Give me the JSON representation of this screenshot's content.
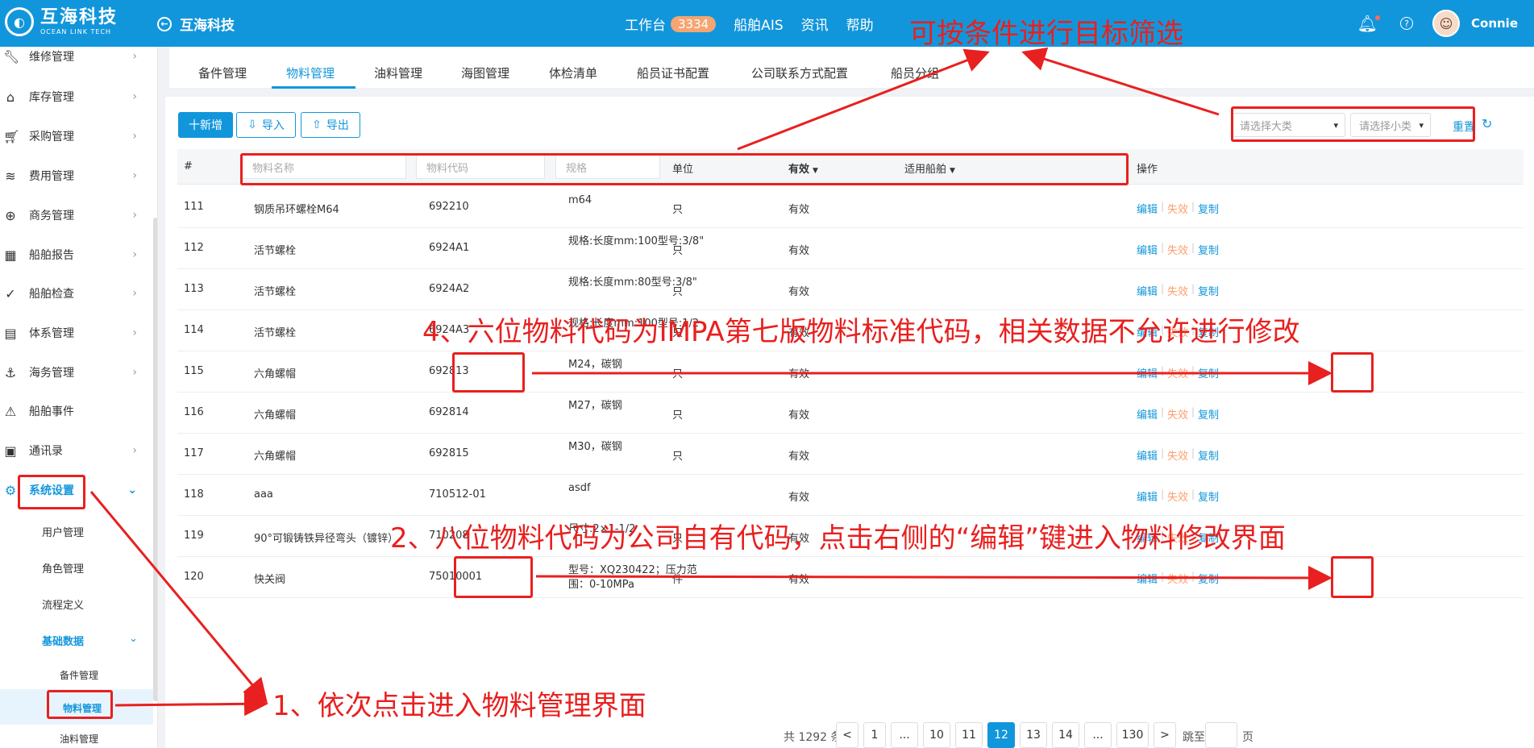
{
  "brand": {
    "name_cn": "互海科技",
    "name_en": "OCEAN LINK TECH"
  },
  "header": {
    "back_label": "互海科技",
    "nav": [
      {
        "label": "工作台",
        "badge": "3334"
      },
      {
        "label": "船舶AIS"
      },
      {
        "label": "资讯"
      },
      {
        "label": "帮助"
      }
    ],
    "username": "Connie"
  },
  "sidebar": {
    "items": [
      {
        "label": "维修管理",
        "icon": "wrench-icon"
      },
      {
        "label": "库存管理",
        "icon": "warehouse-icon"
      },
      {
        "label": "采购管理",
        "icon": "cart-icon"
      },
      {
        "label": "费用管理",
        "icon": "coins-icon"
      },
      {
        "label": "商务管理",
        "icon": "globe-icon"
      },
      {
        "label": "船舶报告",
        "icon": "calendar-icon"
      },
      {
        "label": "船舶检查",
        "icon": "check-circle-icon"
      },
      {
        "label": "体系管理",
        "icon": "document-icon"
      },
      {
        "label": "海务管理",
        "icon": "anchor-icon"
      },
      {
        "label": "船舶事件",
        "icon": "warning-icon"
      },
      {
        "label": "通讯录",
        "icon": "contacts-icon"
      },
      {
        "label": "系统设置",
        "icon": "gear-icon"
      }
    ],
    "sub_items": [
      "用户管理",
      "角色管理",
      "流程定义",
      "基础数据"
    ],
    "sub_sub_items": [
      "备件管理",
      "物料管理",
      "油料管理"
    ]
  },
  "tabs": [
    "备件管理",
    "物料管理",
    "油料管理",
    "海图管理",
    "体检清单",
    "船员证书配置",
    "公司联系方式配置",
    "船员分组"
  ],
  "toolbar": {
    "add": "十新增",
    "import": "导入",
    "export": "导出",
    "category_placeholder": "请选择大类",
    "subcategory_placeholder": "请选择小类",
    "reset": "重置"
  },
  "table": {
    "headers": {
      "index": "#",
      "name_placeholder": "物料名称",
      "code_placeholder": "物料代码",
      "spec_placeholder": "规格",
      "unit": "单位",
      "valid": "有效",
      "ship": "适用船舶",
      "actions": "操作"
    },
    "actions": {
      "edit": "编辑",
      "disable": "失效",
      "copy": "复制"
    },
    "rows": [
      {
        "no": "111",
        "name": "钢质吊环螺栓M64",
        "code": "692210",
        "spec": "m64",
        "unit": "只",
        "valid": "有效"
      },
      {
        "no": "112",
        "name": "活节螺栓",
        "code": "6924A1",
        "spec": "规格:长度mm:100型号:3/8\"",
        "unit": "只",
        "valid": "有效"
      },
      {
        "no": "113",
        "name": "活节螺栓",
        "code": "6924A2",
        "spec": "规格:长度mm:80型号:3/8\"",
        "unit": "只",
        "valid": "有效"
      },
      {
        "no": "114",
        "name": "活节螺栓",
        "code": "6924A3",
        "spec": "规格:长度mm:100型号:1/2",
        "unit": "只",
        "valid": "有效"
      },
      {
        "no": "115",
        "name": "六角螺帽",
        "code": "692813",
        "spec": "M24，碳钢",
        "unit": "只",
        "valid": "有效"
      },
      {
        "no": "116",
        "name": "六角螺帽",
        "code": "692814",
        "spec": "M27，碳钢",
        "unit": "只",
        "valid": "有效"
      },
      {
        "no": "117",
        "name": "六角螺帽",
        "code": "692815",
        "spec": "M30，碳钢",
        "unit": "只",
        "valid": "有效"
      },
      {
        "no": "118",
        "name": "aaa",
        "code": "710512-01",
        "spec": "asdf",
        "unit": "",
        "valid": "有效"
      },
      {
        "no": "119",
        "name": "90°可锻铸铁异径弯头（镀锌）",
        "code": "710208",
        "spec": "尺寸:2×1-1/2",
        "unit": "只",
        "valid": "有效"
      },
      {
        "no": "120",
        "name": "快关阀",
        "code": "75010001",
        "spec": "型号：XQ230422；压力范围：0-10MPa",
        "unit": "件",
        "valid": "有效"
      }
    ]
  },
  "pagination": {
    "total_text": "共 1292 条",
    "pages": [
      "<",
      "1",
      "...",
      "10",
      "11",
      "12",
      "13",
      "14",
      "...",
      "130",
      ">"
    ],
    "current": "12",
    "jump_label": "跳至",
    "page_label": "页"
  },
  "annotations": {
    "title": "可按条件进行目标筛选",
    "note1": "1、依次点击进入物料管理界面",
    "note2": "2、八位物料代码为公司自有代码，点击右侧的“编辑”键进入物料修改界面",
    "note4": "4、六位物料代码为IMPA第七版物料标准代码，相关数据不允许进行修改",
    "color": "#e8201f"
  },
  "colors": {
    "primary": "#1296db",
    "warn": "#ff9d6e"
  }
}
